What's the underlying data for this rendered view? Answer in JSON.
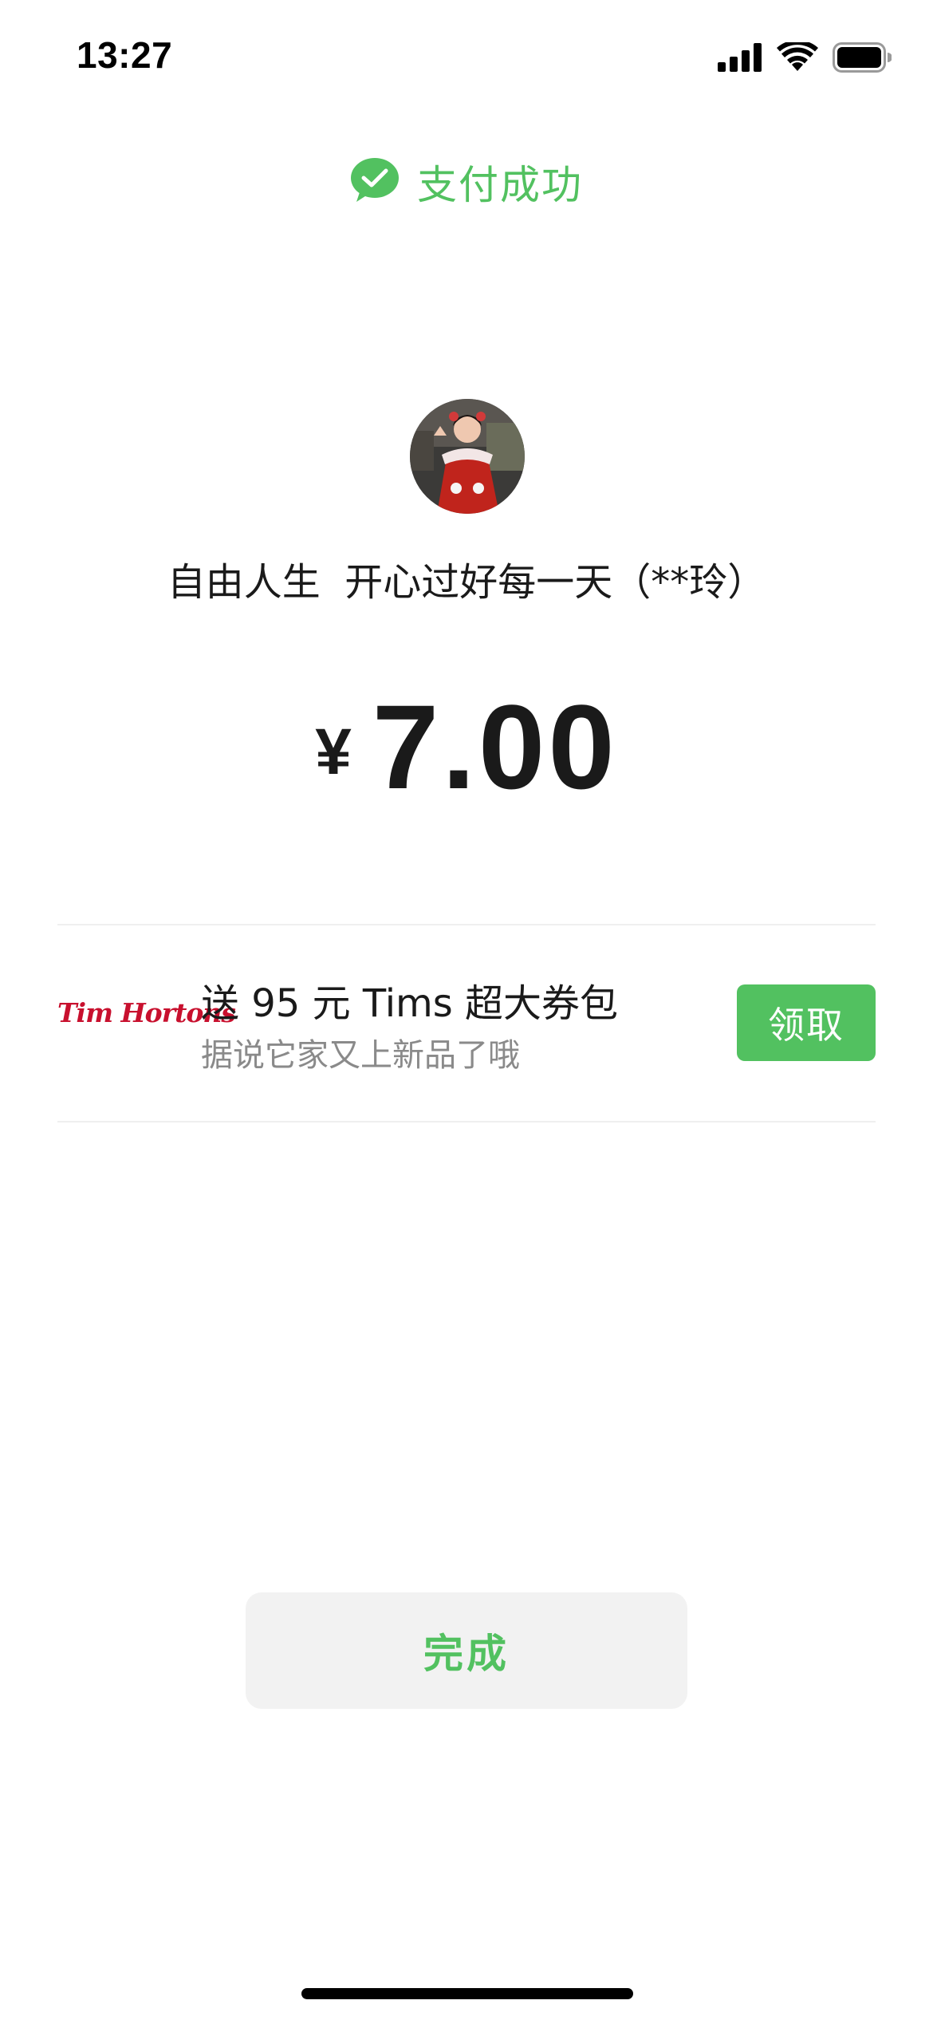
{
  "status_bar": {
    "time": "13:27",
    "icons": [
      "cellular-signal-icon",
      "wifi-icon",
      "battery-icon"
    ]
  },
  "header": {
    "icon": "wechat-icon",
    "title": "支付成功",
    "accent_color": "#52c160"
  },
  "payee": {
    "avatar": "avatar-photo",
    "name": "自由人生  开心过好每一天（**玲）"
  },
  "amount": {
    "currency_symbol": "¥",
    "value": "7.00"
  },
  "promo": {
    "logo_text": "Tim Hortons",
    "logo_color": "#c8102e",
    "title": "送 95 元 Tims 超大券包",
    "subtitle": "据说它家又上新品了哦",
    "button_label": "领取"
  },
  "footer": {
    "done_label": "完成"
  }
}
